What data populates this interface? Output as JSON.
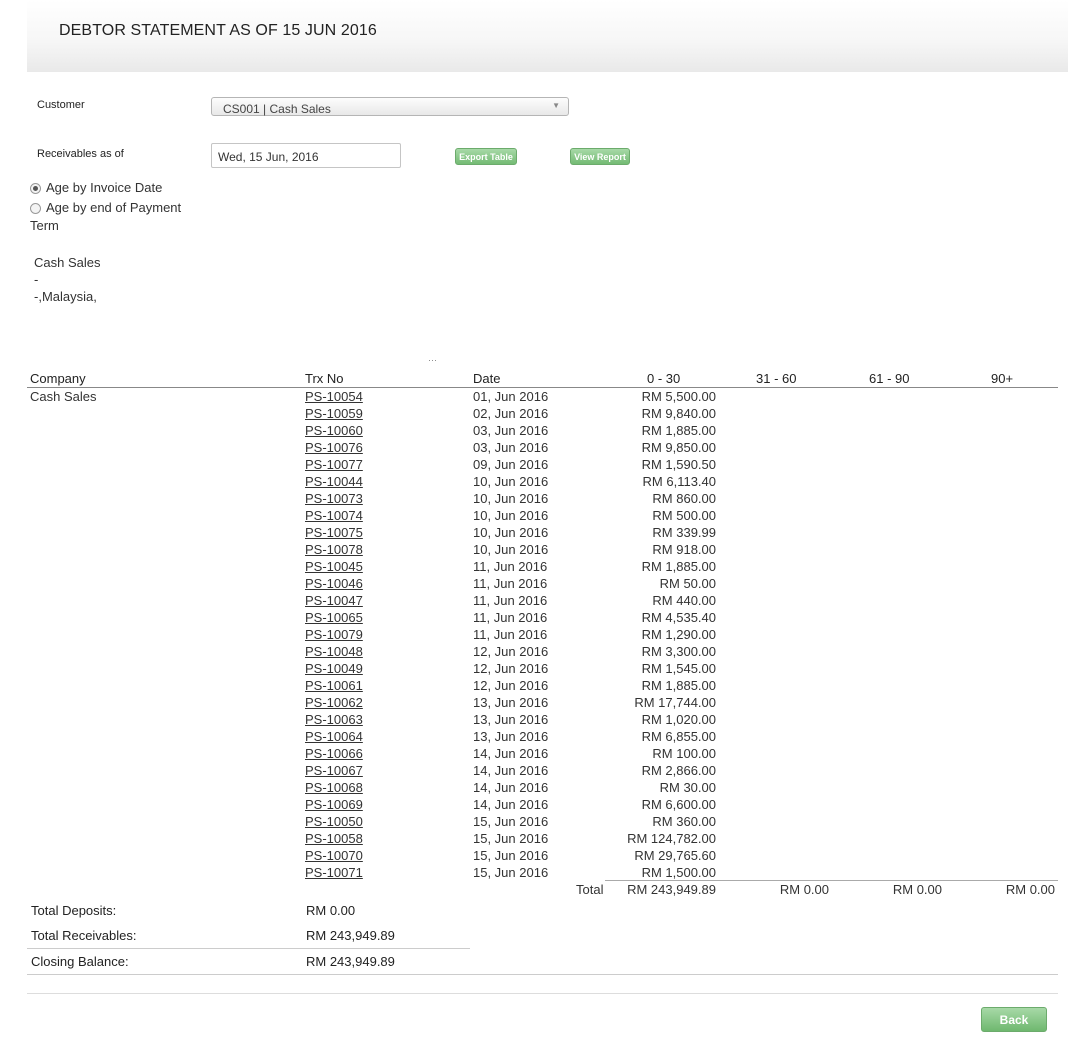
{
  "page": {
    "title": "DEBTOR STATEMENT AS OF 15 JUN 2016"
  },
  "filters": {
    "customer_label": "Customer",
    "customer_value": "CS001 | Cash Sales",
    "receivables_label": "Receivables as of",
    "receivables_value": "Wed, 15 Jun, 2016",
    "export_label": "Export Table",
    "view_label": "View Report",
    "age_invoice_label": "Age by Invoice Date",
    "age_payment_label_1": "Age by end of Payment",
    "age_payment_label_2": "Term",
    "age_selected": "invoice"
  },
  "address": {
    "line1": "Cash Sales",
    "line2": "-",
    "line3": "-,Malaysia,"
  },
  "table": {
    "headers": {
      "company": "Company",
      "trx": "Trx No",
      "date": "Date",
      "b0_30": "0 - 30",
      "b31_60": "31 - 60",
      "b61_90": "61 - 90",
      "b90": "90+"
    },
    "company": "Cash Sales",
    "rows": [
      {
        "trx": "PS-10054",
        "date": "01, Jun 2016",
        "amount": "RM 5,500.00"
      },
      {
        "trx": "PS-10059",
        "date": "02, Jun 2016",
        "amount": "RM 9,840.00"
      },
      {
        "trx": "PS-10060",
        "date": "03, Jun 2016",
        "amount": "RM 1,885.00"
      },
      {
        "trx": "PS-10076",
        "date": "03, Jun 2016",
        "amount": "RM 9,850.00"
      },
      {
        "trx": "PS-10077",
        "date": "09, Jun 2016",
        "amount": "RM 1,590.50"
      },
      {
        "trx": "PS-10044",
        "date": "10, Jun 2016",
        "amount": "RM 6,113.40"
      },
      {
        "trx": "PS-10073",
        "date": "10, Jun 2016",
        "amount": "RM 860.00"
      },
      {
        "trx": "PS-10074",
        "date": "10, Jun 2016",
        "amount": "RM 500.00"
      },
      {
        "trx": "PS-10075",
        "date": "10, Jun 2016",
        "amount": "RM 339.99"
      },
      {
        "trx": "PS-10078",
        "date": "10, Jun 2016",
        "amount": "RM 918.00"
      },
      {
        "trx": "PS-10045",
        "date": "11, Jun 2016",
        "amount": "RM 1,885.00"
      },
      {
        "trx": "PS-10046",
        "date": "11, Jun 2016",
        "amount": "RM 50.00"
      },
      {
        "trx": "PS-10047",
        "date": "11, Jun 2016",
        "amount": "RM 440.00"
      },
      {
        "trx": "PS-10065",
        "date": "11, Jun 2016",
        "amount": "RM 4,535.40"
      },
      {
        "trx": "PS-10079",
        "date": "11, Jun 2016",
        "amount": "RM 1,290.00"
      },
      {
        "trx": "PS-10048",
        "date": "12, Jun 2016",
        "amount": "RM 3,300.00"
      },
      {
        "trx": "PS-10049",
        "date": "12, Jun 2016",
        "amount": "RM 1,545.00"
      },
      {
        "trx": "PS-10061",
        "date": "12, Jun 2016",
        "amount": "RM 1,885.00"
      },
      {
        "trx": "PS-10062",
        "date": "13, Jun 2016",
        "amount": "RM 17,744.00"
      },
      {
        "trx": "PS-10063",
        "date": "13, Jun 2016",
        "amount": "RM 1,020.00"
      },
      {
        "trx": "PS-10064",
        "date": "13, Jun 2016",
        "amount": "RM 6,855.00"
      },
      {
        "trx": "PS-10066",
        "date": "14, Jun 2016",
        "amount": "RM 100.00"
      },
      {
        "trx": "PS-10067",
        "date": "14, Jun 2016",
        "amount": "RM 2,866.00"
      },
      {
        "trx": "PS-10068",
        "date": "14, Jun 2016",
        "amount": "RM 30.00"
      },
      {
        "trx": "PS-10069",
        "date": "14, Jun 2016",
        "amount": "RM 6,600.00"
      },
      {
        "trx": "PS-10050",
        "date": "15, Jun 2016",
        "amount": "RM 360.00"
      },
      {
        "trx": "PS-10058",
        "date": "15, Jun 2016",
        "amount": "RM 124,782.00"
      },
      {
        "trx": "PS-10070",
        "date": "15, Jun 2016",
        "amount": "RM 29,765.60"
      },
      {
        "trx": "PS-10071",
        "date": "15, Jun 2016",
        "amount": "RM 1,500.00"
      }
    ],
    "totals": {
      "label": "Total",
      "b0_30": "RM 243,949.89",
      "b31_60": "RM 0.00",
      "b61_90": "RM 0.00",
      "b90": "RM 0.00"
    }
  },
  "summary": {
    "deposits_label": "Total Deposits:",
    "deposits_value": "RM 0.00",
    "receivables_label": "Total Receivables:",
    "receivables_value": "RM 243,949.89",
    "closing_label": "Closing Balance:",
    "closing_value": "RM 243,949.89"
  },
  "actions": {
    "back_label": "Back"
  }
}
